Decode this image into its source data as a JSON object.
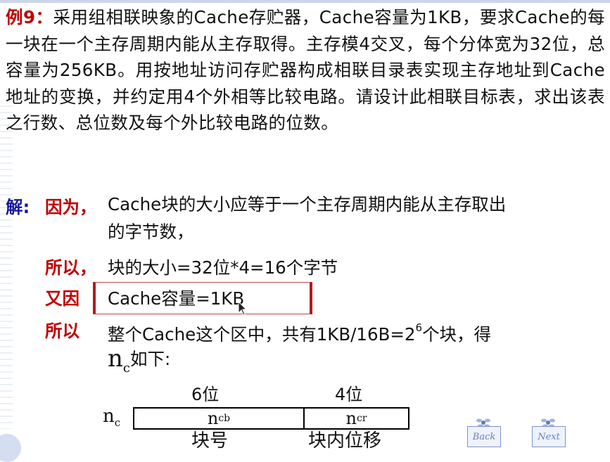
{
  "problem": {
    "label": "例9：",
    "text": "采用组相联映象的Cache存贮器，Cache容量为1KB，要求Cache的每一块在一个主存周期内能从主存取得。主存模4交叉，每个分体宽为32位，总容量为256KB。用按地址访问存贮器构成相联目录表实现主存地址到Cache地址的变换，并约定用4个外相等比较电路。请设计此相联目标表，求出该表之行数、总位数及每个外比较电路的位数。"
  },
  "solution": {
    "label": "解:",
    "because": "因为，",
    "line1": "Cache块的大小应等于一个主存周期内能从主存取出",
    "line2": "的字节数，",
    "so1_label": "所以，",
    "so1_text": "块的大小=32位*4=16个字节",
    "again_label": "又因",
    "again_text": "Cache容量=1KB",
    "so2_label": "所以",
    "so2_text_a": "整个Cache这个区中，共有1KB/16B=2",
    "so2_sup": "6",
    "so2_text_b": "个块，得",
    "nc_n": "n",
    "nc_sub": "c",
    "nc_text": "如下:"
  },
  "diagram": {
    "bits_block": "6位",
    "bits_offset": "4位",
    "reg_n": "n",
    "reg_sub": "c",
    "field1_n": "n",
    "field1_sub": "cb",
    "field2_n": "n",
    "field2_sub": "cr",
    "caption_block": "块号",
    "caption_offset": "块内位移"
  },
  "nav": {
    "back_label": "Back",
    "next_label": "Next"
  },
  "colors": {
    "accent_red": "#c00000",
    "accent_blue": "#1a1aa0"
  }
}
